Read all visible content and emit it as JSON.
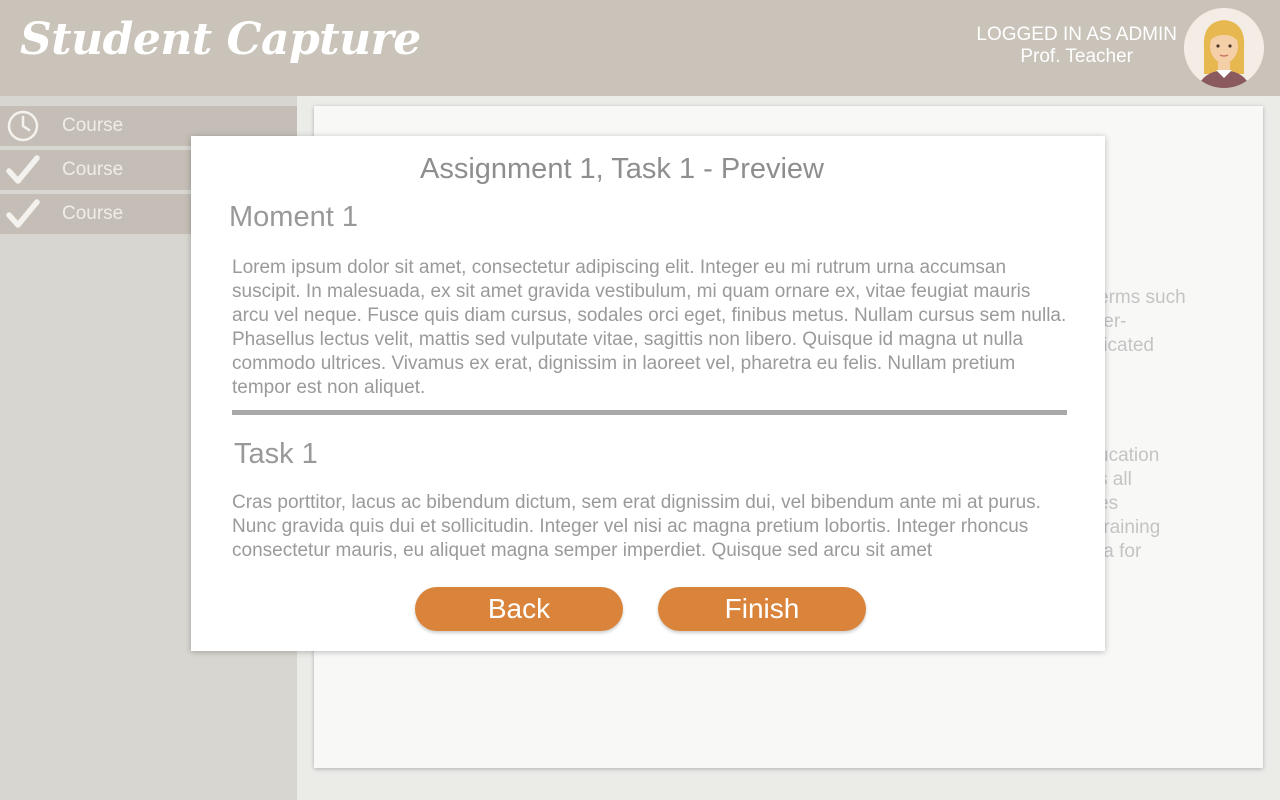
{
  "app": {
    "logo_text": "Student Capture"
  },
  "user": {
    "role_text": "LOGGED IN AS ADMIN",
    "name": "Prof. Teacher"
  },
  "sidebar": {
    "items": [
      {
        "label": "Course",
        "icon": "clock-icon"
      },
      {
        "label": "Course",
        "icon": "check-icon"
      },
      {
        "label": "Course",
        "icon": "check-icon"
      }
    ]
  },
  "background_fragments": {
    "block1": [
      "erms such",
      "ter-",
      "ticated"
    ],
    "block2": [
      "ucation",
      "s all",
      "es",
      "training",
      "ta for"
    ]
  },
  "modal": {
    "title": "Assignment 1, Task 1 - Preview",
    "moment_heading": "Moment 1",
    "moment_text": "Lorem ipsum dolor sit amet, consectetur adipiscing elit. Integer eu mi rutrum urna accumsan suscipit. In malesuada, ex sit amet gravida vestibulum, mi quam ornare ex, vitae feugiat mauris arcu vel neque. Fusce quis diam cursus, sodales orci eget, finibus metus. Nullam cursus sem nulla. Phasellus lectus velit, mattis sed vulputate vitae, sagittis non libero. Quisque id magna ut nulla commodo ultrices. Vivamus ex erat, dignissim in laoreet vel, pharetra eu felis. Nullam pretium tempor est non aliquet.",
    "task_heading": "Task 1",
    "task_text": "Cras porttitor, lacus ac bibendum dictum, sem erat dignissim dui, vel bibendum ante mi at purus. Nunc gravida quis dui et sollicitudin. Integer vel nisi ac magna pretium lobortis. Integer rhoncus consectetur mauris, eu aliquet magna semper imperdiet. Quisque sed arcu sit amet",
    "back_label": "Back",
    "finish_label": "Finish"
  },
  "colors": {
    "header_bg": "#c9c3b9",
    "sidebar_bg": "#d8d6d0",
    "sidebar_item_bg": "#c4beb6",
    "button_accent": "#d9843a"
  }
}
